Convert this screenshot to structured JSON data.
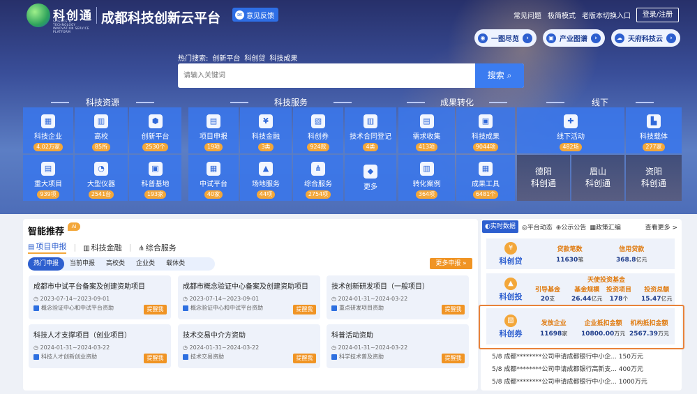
{
  "header": {
    "logo_text": "科创通",
    "logo_sub": "SCIENCE & TECHNOLOGY INNOVATION SERVICE PLATFORM",
    "title": "成都科技创新云平台",
    "feedback": "意见反馈",
    "links": [
      "常见问题",
      "极简模式",
      "老版本切换入口"
    ],
    "login": "登录/注册",
    "pills": [
      {
        "icon": "overview-icon",
        "label": "一图尽览"
      },
      {
        "icon": "map-icon",
        "label": "产业图谱"
      },
      {
        "icon": "cloud-icon",
        "label": "天府科技云"
      }
    ]
  },
  "search": {
    "hot_label": "热门搜索:",
    "hot_items": [
      "创新平台",
      "科创贷",
      "科技成果"
    ],
    "placeholder": "请输入关键词",
    "button": "搜索"
  },
  "sections": {
    "resources": {
      "title": "科技资源",
      "tiles": [
        {
          "label": "科技企业",
          "count": "4.02万家",
          "icon": "building-icon",
          "glyph": "▦"
        },
        {
          "label": "高校",
          "count": "85所",
          "icon": "school-icon",
          "glyph": "▥"
        },
        {
          "label": "创新平台",
          "count": "2530个",
          "icon": "hexagon-icon",
          "glyph": "⬢"
        },
        {
          "label": "重大项目",
          "count": "939项",
          "icon": "briefcase-icon",
          "glyph": "▤"
        },
        {
          "label": "大型仪器",
          "count": "2541台",
          "icon": "gauge-icon",
          "glyph": "◔"
        },
        {
          "label": "科普基地",
          "count": "193家",
          "icon": "folder-icon",
          "glyph": "▣"
        }
      ]
    },
    "services": {
      "title": "科技服务",
      "tiles": [
        {
          "label": "项目申报",
          "count": "19项",
          "icon": "report-icon",
          "glyph": "▤"
        },
        {
          "label": "科技金融",
          "count": "3类",
          "icon": "money-bag-icon",
          "glyph": "¥"
        },
        {
          "label": "科创券",
          "count": "924款",
          "icon": "coupon-icon",
          "glyph": "▧"
        },
        {
          "label": "技术合同登记",
          "count": "4类",
          "icon": "contract-icon",
          "glyph": "▥"
        },
        {
          "label": "中试平台",
          "count": "40家",
          "icon": "flask-icon",
          "glyph": "▦"
        },
        {
          "label": "场地服务",
          "count": "44项",
          "icon": "venue-icon",
          "glyph": "▲"
        },
        {
          "label": "综合服务",
          "count": "2754项",
          "icon": "org-chart-icon",
          "glyph": "⋔"
        },
        {
          "label": "更多",
          "count": "",
          "icon": "grid-more-icon",
          "glyph": "◆"
        }
      ]
    },
    "results": {
      "title": "成果转化",
      "tiles": [
        {
          "label": "需求收集",
          "count": "413项",
          "icon": "list-icon",
          "glyph": "▤"
        },
        {
          "label": "科技成果",
          "count": "9044项",
          "icon": "folder-icon",
          "glyph": "▣"
        },
        {
          "label": "转化案例",
          "count": "364项",
          "icon": "bar-chart-icon",
          "glyph": "▥"
        },
        {
          "label": "成果工具",
          "count": "6481个",
          "icon": "document-icon",
          "glyph": "▦"
        }
      ]
    },
    "offline": {
      "title": "线下",
      "tiles": [
        {
          "label": "线下活动",
          "count": "482场",
          "icon": "gift-icon",
          "glyph": "✚"
        },
        {
          "label": "科技载体",
          "count": "277家",
          "icon": "carrier-icon",
          "glyph": "▙"
        }
      ],
      "cities": [
        {
          "name": "德阳",
          "suffix": "科创通"
        },
        {
          "name": "眉山",
          "suffix": "科创通"
        },
        {
          "name": "资阳",
          "suffix": "科创通"
        }
      ]
    }
  },
  "recommend": {
    "title": "智能推荐",
    "ai_badge": "AI",
    "categories": [
      {
        "label": "项目申报",
        "icon": "report-icon"
      },
      {
        "label": "科技金融",
        "icon": "bag-icon"
      },
      {
        "label": "综合服务",
        "icon": "org-icon"
      }
    ],
    "sub_tabs": [
      "热门申报",
      "当前申报",
      "高校类",
      "企业类",
      "载体类"
    ],
    "more": "更多申报 »",
    "tag": "提醒我",
    "cards": [
      {
        "title": "成都市中试平台备案及创建资助项目",
        "date": "2023-07-14~2023-09-01",
        "source": "概念验证中心和中试平台资助"
      },
      {
        "title": "成都市概念验证中心备案及创建资助项目",
        "date": "2023-07-14~2023-09-01",
        "source": "概念验证中心和中试平台资助"
      },
      {
        "title": "技术创新研发项目（一般项目）",
        "date": "2024-01-31~2024-03-22",
        "source": "重点研发项目资助"
      },
      {
        "title": "科技人才支撑项目（创业项目）",
        "date": "2024-01-31~2024-03-22",
        "source": "科技人才创新创业资助"
      },
      {
        "title": "技术交易中介方资助",
        "date": "2024-01-31~2024-03-22",
        "source": "技术交易资助"
      },
      {
        "title": "科普活动资助",
        "date": "2024-01-31~2024-03-22",
        "source": "科学技术普及资助"
      }
    ]
  },
  "realtime": {
    "tabs": [
      "实时数据",
      "平台动态",
      "公示公告",
      "政策汇编",
      "查看更多 >"
    ],
    "kcd": {
      "name": "科创贷",
      "items": [
        {
          "k": "贷款笔数",
          "v": "11630",
          "u": "笔"
        },
        {
          "k": "信用贷款",
          "v": "368.8",
          "u": "亿元"
        }
      ]
    },
    "kct": {
      "name": "科创投",
      "fund": "天使投资基金",
      "items": [
        {
          "k": "引导基金",
          "v": "20",
          "u": "支"
        },
        {
          "k": "基金规模",
          "v": "26.44",
          "u": "亿元"
        },
        {
          "k": "投资项目",
          "v": "178",
          "u": "个"
        },
        {
          "k": "投资总额",
          "v": "15.47",
          "u": "亿元"
        }
      ]
    },
    "kcq": {
      "name": "科创券",
      "items": [
        {
          "k": "发放企业",
          "v": "11698",
          "u": "家"
        },
        {
          "k": "企业抵扣金额",
          "v": "10800.00",
          "u": "万元"
        },
        {
          "k": "机构抵扣金额",
          "v": "2567.39",
          "u": "万元"
        }
      ]
    },
    "ticker": [
      "5/8    成都********公司申请成都银行中小企...  150万元",
      "5/8    成都********公司申请成都银行高新支...  400万元",
      "5/8    成都********公司申请成都银行中小企...  1000万元"
    ]
  },
  "colors": {
    "accent": "#2d5fcf",
    "orange": "#f09424",
    "tile": "#3a76eb",
    "highlight": "#e8823a"
  }
}
